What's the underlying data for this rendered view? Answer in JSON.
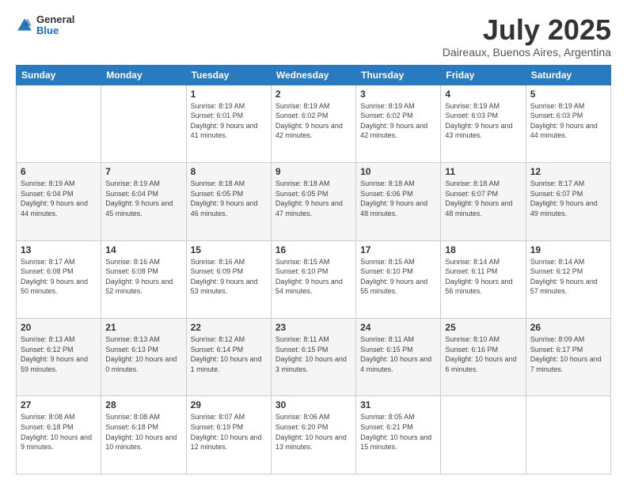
{
  "header": {
    "logo_general": "General",
    "logo_blue": "Blue",
    "month": "July 2025",
    "location": "Daireaux, Buenos Aires, Argentina"
  },
  "days_of_week": [
    "Sunday",
    "Monday",
    "Tuesday",
    "Wednesday",
    "Thursday",
    "Friday",
    "Saturday"
  ],
  "weeks": [
    [
      {
        "day": "",
        "sunrise": "",
        "sunset": "",
        "daylight": ""
      },
      {
        "day": "",
        "sunrise": "",
        "sunset": "",
        "daylight": ""
      },
      {
        "day": "1",
        "sunrise": "Sunrise: 8:19 AM",
        "sunset": "Sunset: 6:01 PM",
        "daylight": "Daylight: 9 hours and 41 minutes."
      },
      {
        "day": "2",
        "sunrise": "Sunrise: 8:19 AM",
        "sunset": "Sunset: 6:02 PM",
        "daylight": "Daylight: 9 hours and 42 minutes."
      },
      {
        "day": "3",
        "sunrise": "Sunrise: 8:19 AM",
        "sunset": "Sunset: 6:02 PM",
        "daylight": "Daylight: 9 hours and 42 minutes."
      },
      {
        "day": "4",
        "sunrise": "Sunrise: 8:19 AM",
        "sunset": "Sunset: 6:03 PM",
        "daylight": "Daylight: 9 hours and 43 minutes."
      },
      {
        "day": "5",
        "sunrise": "Sunrise: 8:19 AM",
        "sunset": "Sunset: 6:03 PM",
        "daylight": "Daylight: 9 hours and 44 minutes."
      }
    ],
    [
      {
        "day": "6",
        "sunrise": "Sunrise: 8:19 AM",
        "sunset": "Sunset: 6:04 PM",
        "daylight": "Daylight: 9 hours and 44 minutes."
      },
      {
        "day": "7",
        "sunrise": "Sunrise: 8:19 AM",
        "sunset": "Sunset: 6:04 PM",
        "daylight": "Daylight: 9 hours and 45 minutes."
      },
      {
        "day": "8",
        "sunrise": "Sunrise: 8:18 AM",
        "sunset": "Sunset: 6:05 PM",
        "daylight": "Daylight: 9 hours and 46 minutes."
      },
      {
        "day": "9",
        "sunrise": "Sunrise: 8:18 AM",
        "sunset": "Sunset: 6:05 PM",
        "daylight": "Daylight: 9 hours and 47 minutes."
      },
      {
        "day": "10",
        "sunrise": "Sunrise: 8:18 AM",
        "sunset": "Sunset: 6:06 PM",
        "daylight": "Daylight: 9 hours and 48 minutes."
      },
      {
        "day": "11",
        "sunrise": "Sunrise: 8:18 AM",
        "sunset": "Sunset: 6:07 PM",
        "daylight": "Daylight: 9 hours and 48 minutes."
      },
      {
        "day": "12",
        "sunrise": "Sunrise: 8:17 AM",
        "sunset": "Sunset: 6:07 PM",
        "daylight": "Daylight: 9 hours and 49 minutes."
      }
    ],
    [
      {
        "day": "13",
        "sunrise": "Sunrise: 8:17 AM",
        "sunset": "Sunset: 6:08 PM",
        "daylight": "Daylight: 9 hours and 50 minutes."
      },
      {
        "day": "14",
        "sunrise": "Sunrise: 8:16 AM",
        "sunset": "Sunset: 6:08 PM",
        "daylight": "Daylight: 9 hours and 52 minutes."
      },
      {
        "day": "15",
        "sunrise": "Sunrise: 8:16 AM",
        "sunset": "Sunset: 6:09 PM",
        "daylight": "Daylight: 9 hours and 53 minutes."
      },
      {
        "day": "16",
        "sunrise": "Sunrise: 8:15 AM",
        "sunset": "Sunset: 6:10 PM",
        "daylight": "Daylight: 9 hours and 54 minutes."
      },
      {
        "day": "17",
        "sunrise": "Sunrise: 8:15 AM",
        "sunset": "Sunset: 6:10 PM",
        "daylight": "Daylight: 9 hours and 55 minutes."
      },
      {
        "day": "18",
        "sunrise": "Sunrise: 8:14 AM",
        "sunset": "Sunset: 6:11 PM",
        "daylight": "Daylight: 9 hours and 56 minutes."
      },
      {
        "day": "19",
        "sunrise": "Sunrise: 8:14 AM",
        "sunset": "Sunset: 6:12 PM",
        "daylight": "Daylight: 9 hours and 57 minutes."
      }
    ],
    [
      {
        "day": "20",
        "sunrise": "Sunrise: 8:13 AM",
        "sunset": "Sunset: 6:12 PM",
        "daylight": "Daylight: 9 hours and 59 minutes."
      },
      {
        "day": "21",
        "sunrise": "Sunrise: 8:13 AM",
        "sunset": "Sunset: 6:13 PM",
        "daylight": "Daylight: 10 hours and 0 minutes."
      },
      {
        "day": "22",
        "sunrise": "Sunrise: 8:12 AM",
        "sunset": "Sunset: 6:14 PM",
        "daylight": "Daylight: 10 hours and 1 minute."
      },
      {
        "day": "23",
        "sunrise": "Sunrise: 8:11 AM",
        "sunset": "Sunset: 6:15 PM",
        "daylight": "Daylight: 10 hours and 3 minutes."
      },
      {
        "day": "24",
        "sunrise": "Sunrise: 8:11 AM",
        "sunset": "Sunset: 6:15 PM",
        "daylight": "Daylight: 10 hours and 4 minutes."
      },
      {
        "day": "25",
        "sunrise": "Sunrise: 8:10 AM",
        "sunset": "Sunset: 6:16 PM",
        "daylight": "Daylight: 10 hours and 6 minutes."
      },
      {
        "day": "26",
        "sunrise": "Sunrise: 8:09 AM",
        "sunset": "Sunset: 6:17 PM",
        "daylight": "Daylight: 10 hours and 7 minutes."
      }
    ],
    [
      {
        "day": "27",
        "sunrise": "Sunrise: 8:08 AM",
        "sunset": "Sunset: 6:18 PM",
        "daylight": "Daylight: 10 hours and 9 minutes."
      },
      {
        "day": "28",
        "sunrise": "Sunrise: 8:08 AM",
        "sunset": "Sunset: 6:18 PM",
        "daylight": "Daylight: 10 hours and 10 minutes."
      },
      {
        "day": "29",
        "sunrise": "Sunrise: 8:07 AM",
        "sunset": "Sunset: 6:19 PM",
        "daylight": "Daylight: 10 hours and 12 minutes."
      },
      {
        "day": "30",
        "sunrise": "Sunrise: 8:06 AM",
        "sunset": "Sunset: 6:20 PM",
        "daylight": "Daylight: 10 hours and 13 minutes."
      },
      {
        "day": "31",
        "sunrise": "Sunrise: 8:05 AM",
        "sunset": "Sunset: 6:21 PM",
        "daylight": "Daylight: 10 hours and 15 minutes."
      },
      {
        "day": "",
        "sunrise": "",
        "sunset": "",
        "daylight": ""
      },
      {
        "day": "",
        "sunrise": "",
        "sunset": "",
        "daylight": ""
      }
    ]
  ]
}
